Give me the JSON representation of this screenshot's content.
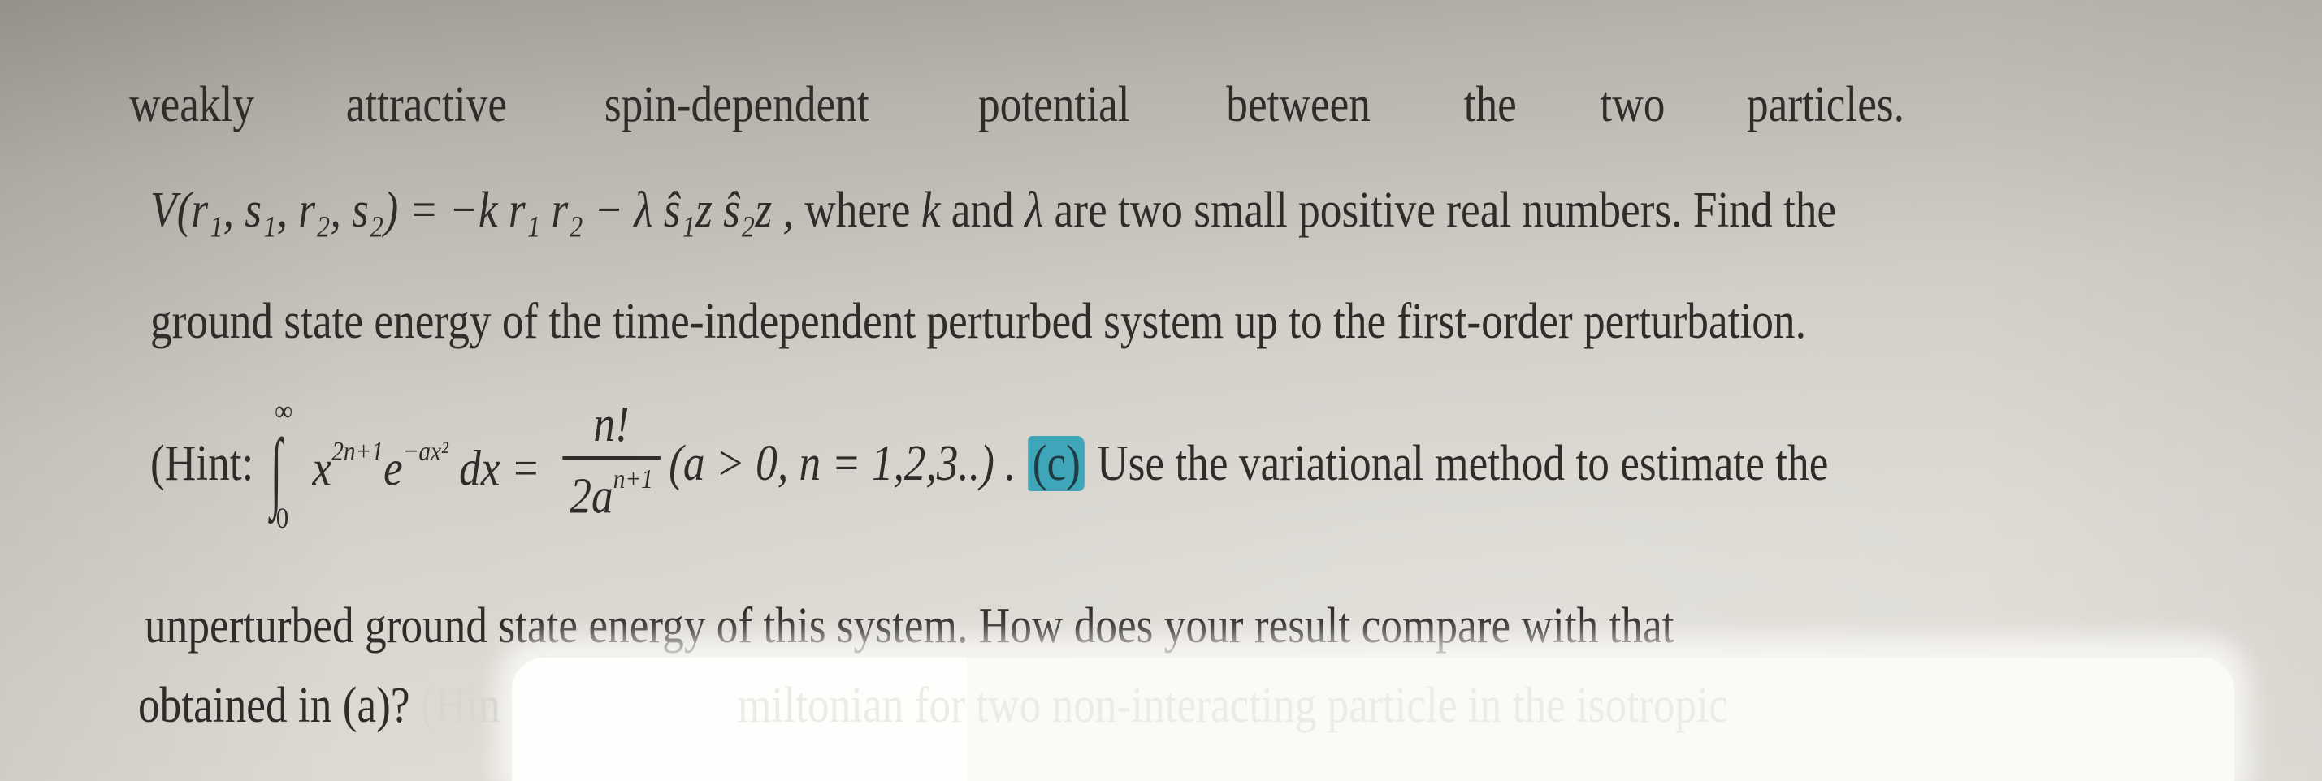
{
  "document": {
    "line1_words": [
      "weakly",
      "attractive",
      "spin-dependent",
      "potential",
      "between",
      "the",
      "two",
      "particles."
    ],
    "line2": {
      "lhs": "V",
      "args": "(r₁, s₁, r₂, s₂)",
      "rhs_term1": "= −k r₁ r₂",
      "rhs_term2": "− λ ŝ₁z ŝ₂z ,",
      "text_after": "where k and λ are two small positive real numbers. Find the",
      "k_symbol": "k",
      "lambda_symbol": "λ",
      "where": "where",
      "and": "and",
      "rest": "are two small positive real numbers. Find the"
    },
    "line3": "ground state energy of the time-independent perturbed system up to the first-order perturbation.",
    "line4": {
      "hint_open": "(Hint:",
      "integral_upper": "∞",
      "integral_lower": "0",
      "integrand_base": "x",
      "integrand_exp": "2n+1",
      "exp_base": "e",
      "exp_exp": "−ax²",
      "differential": "dx =",
      "frac_num": "n!",
      "frac_den_base": "2a",
      "frac_den_exp": "n+1",
      "condition": "(a > 0, n = 1,2,3..) .",
      "part_label": "(c)",
      "part_text": "Use the variational method to estimate the"
    },
    "line5": "unperturbed ground state energy of this system. How does your result compare with that",
    "line6": {
      "visible": "obtained in (a)?",
      "faded_start": "(Hin",
      "faded_rest": "miltonian for two non-interacting particle in the isotropic"
    }
  },
  "colors": {
    "highlight": "#3fa6b9",
    "ink": "#2f2d2a"
  }
}
